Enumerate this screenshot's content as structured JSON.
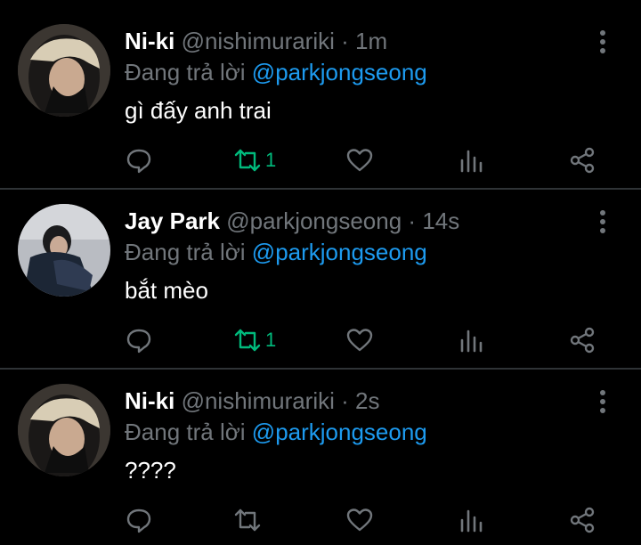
{
  "tweets": [
    {
      "name": "Ni-ki",
      "handle": "@nishimurariki",
      "time": "1m",
      "reply_prefix": "Đang trả lời",
      "reply_to": "@parkjongseong",
      "text": "gì đấy anh trai",
      "retweet_count": "1",
      "retweeted": true
    },
    {
      "name": "Jay Park",
      "handle": "@parkjongseong",
      "time": "14s",
      "reply_prefix": "Đang trả lời",
      "reply_to": "@parkjongseong",
      "text": "bắt mèo",
      "retweet_count": "1",
      "retweeted": true
    },
    {
      "name": "Ni-ki",
      "handle": "@nishimurariki",
      "time": "2s",
      "reply_prefix": "Đang trả lời",
      "reply_to": "@parkjongseong",
      "text": "????",
      "retweet_count": "",
      "retweeted": false
    }
  ],
  "colors": {
    "background": "#000000",
    "muted": "#71767b",
    "link": "#1d9bf0",
    "retweet_active": "#00ba7c",
    "divider": "#2f3336"
  },
  "icons": {
    "reply": "reply-icon",
    "retweet": "retweet-icon",
    "like": "heart-icon",
    "views": "analytics-icon",
    "share": "share-icon",
    "more": "more-vertical-icon"
  }
}
